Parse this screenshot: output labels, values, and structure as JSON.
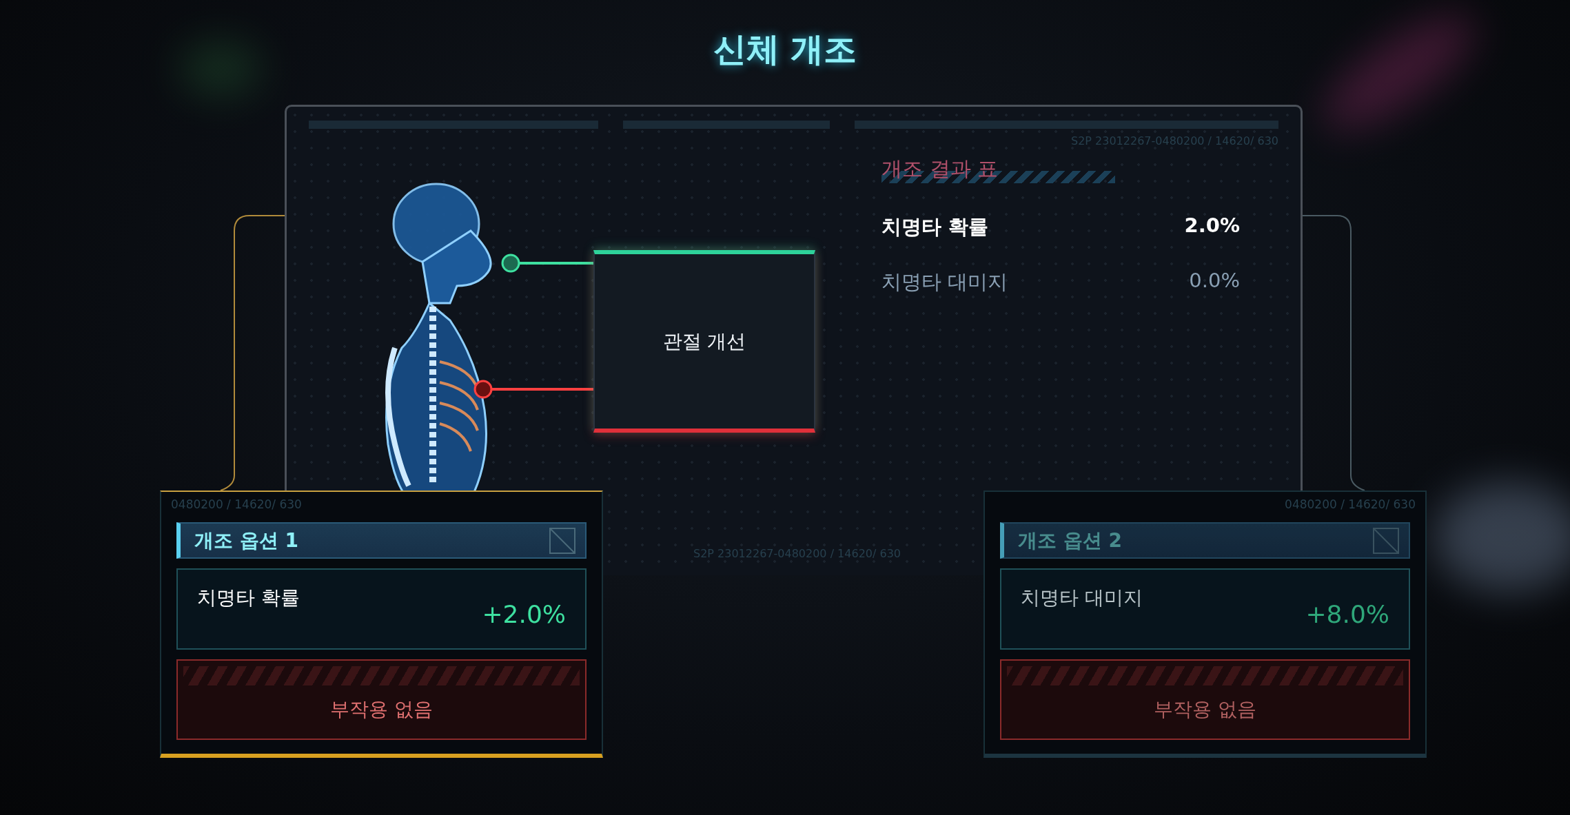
{
  "title": "신체 개조",
  "panel": {
    "code": "S2P 23012267-0480200 / 14620/ 630",
    "footer_code": "S2P 23012267-0480200 / 14620/ 630"
  },
  "implant": {
    "label": "관절 개선"
  },
  "results": {
    "title": "개조 결과 표",
    "rows": [
      {
        "name": "치명타 확률",
        "value": "2.0%",
        "highlighted": true
      },
      {
        "name": "치명타 대미지",
        "value": "0.0%",
        "highlighted": false
      }
    ]
  },
  "options": [
    {
      "code": "0480200 / 14620/ 630",
      "title": "개조 옵션 1",
      "stat": "치명타 확률",
      "bonus": "+2.0%",
      "side_effect": "부작용 없음",
      "selected": true
    },
    {
      "code": "0480200 / 14620/ 630",
      "title": "개조 옵션 2",
      "stat": "치명타 대미지",
      "bonus": "+8.0%",
      "side_effect": "부작용 없음",
      "selected": false
    }
  ]
}
